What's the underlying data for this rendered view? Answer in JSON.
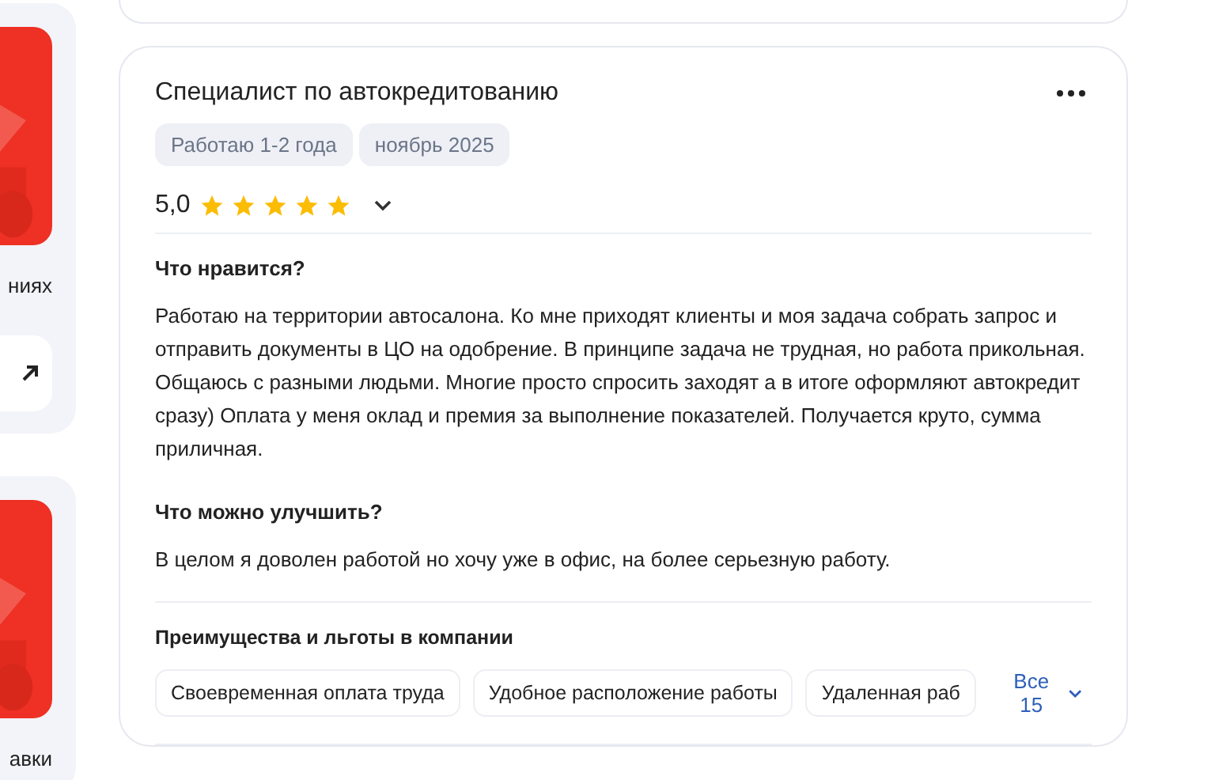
{
  "side_cards": [
    {
      "caption": "ниях",
      "has_link": true
    },
    {
      "caption": "авки",
      "has_link": false
    }
  ],
  "review": {
    "title": "Специалист по автокредитованию",
    "tags": [
      "Работаю 1-2 года",
      "ноябрь 2025"
    ],
    "rating": "5,0",
    "stars": 5,
    "sections": [
      {
        "heading": "Что нравится?",
        "text": "Работаю на территории автосалона. Ко мне приходят клиенты и моя задача собрать запрос и отправить документы в ЦО на одобрение. В принципе задача не трудная, но работа прикольная. Общаюсь с разными людьми. Многие просто спросить заходят а в итоге оформляют автокредит сразу) Оплата у меня оклад и премия за выполнение показателей. Получается круто, сумма приличная."
      },
      {
        "heading": "Что можно улучшить?",
        "text": "В целом я доволен работой но хочу уже в офис, на более серьезную работу."
      }
    ],
    "benefits_title": "Преимущества и льготы в компании",
    "benefits": [
      "Своевременная оплата труда",
      "Удобное расположение работы",
      "Удаленная раб"
    ],
    "all_link": "Все 15"
  }
}
